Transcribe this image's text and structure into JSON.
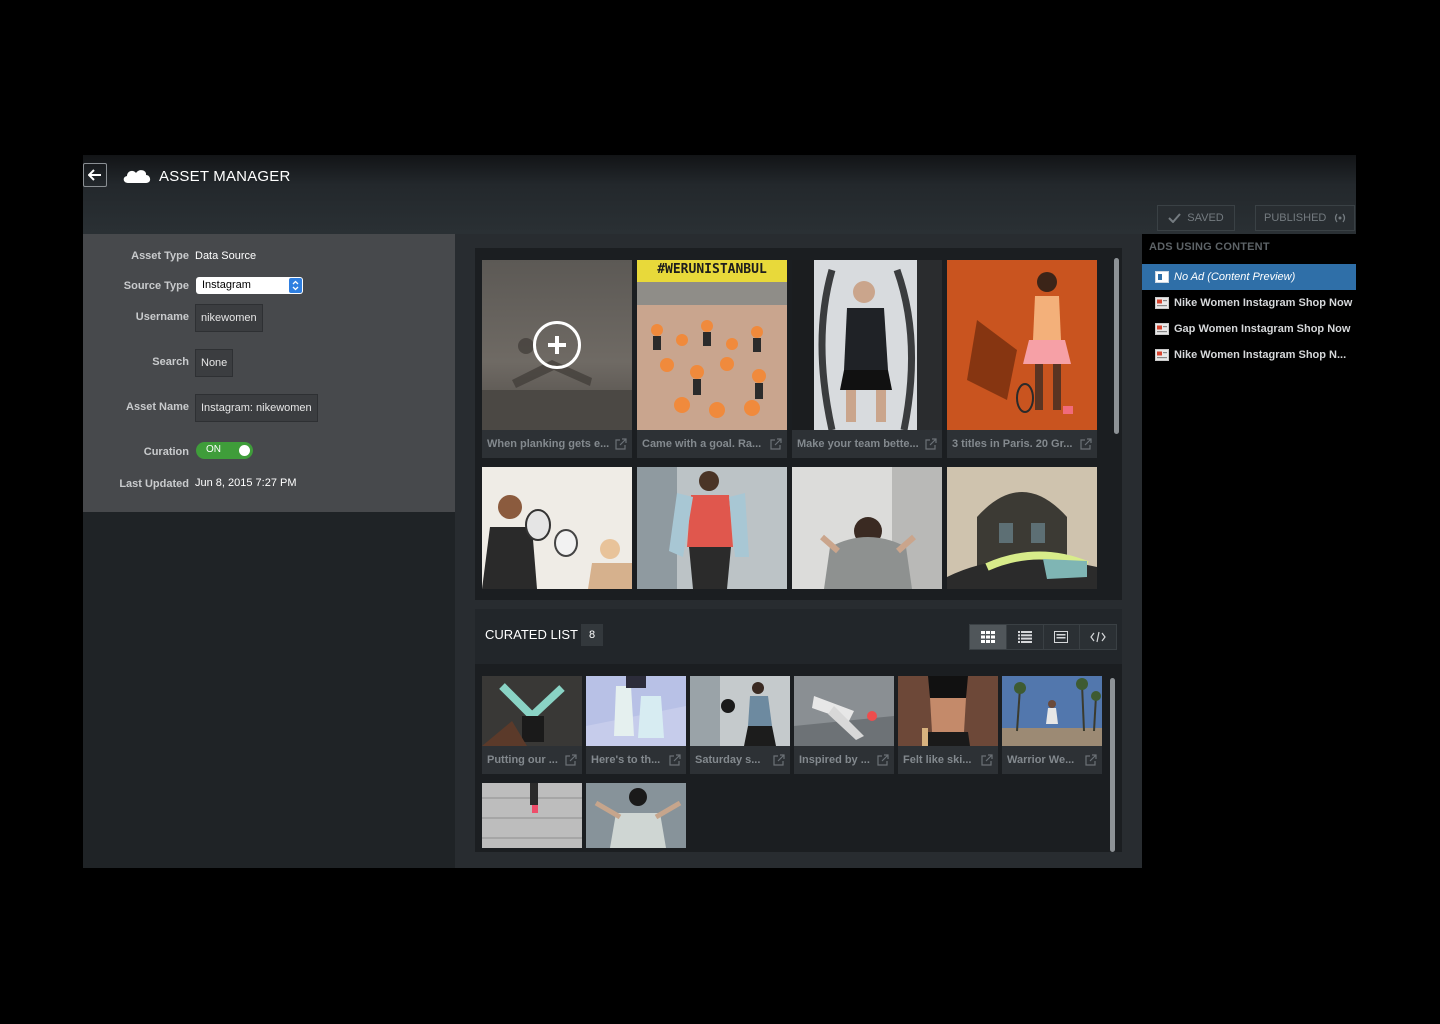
{
  "app": {
    "title": "ASSET MANAGER",
    "saved_label": "SAVED",
    "published_label": "PUBLISHED"
  },
  "form": {
    "asset_type_label": "Asset Type",
    "asset_type_value": "Data Source",
    "source_type_label": "Source Type",
    "source_type_value": "Instagram",
    "username_label": "Username",
    "username_value": "nikewomen",
    "search_label": "Search",
    "search_value": "None",
    "asset_name_label": "Asset Name",
    "asset_name_value": "Instagram: nikewomen",
    "curation_label": "Curation",
    "curation_value": "ON",
    "last_updated_label": "Last Updated",
    "last_updated_value": "Jun 8, 2015 7:27 PM"
  },
  "source_grid": {
    "tiles": [
      {
        "caption": "When planking gets e...",
        "add": true
      },
      {
        "caption": "Came with a goal. Ra..."
      },
      {
        "caption": "Make your team bette..."
      },
      {
        "caption": "3 titles in Paris. 20 Gr..."
      },
      {
        "caption": ""
      },
      {
        "caption": ""
      },
      {
        "caption": ""
      },
      {
        "caption": ""
      }
    ],
    "banner_text": "#WERUNISTANBUL"
  },
  "curated": {
    "title": "CURATED LIST",
    "count": "8",
    "tiles": [
      {
        "caption": "Putting our ..."
      },
      {
        "caption": "Here's to th..."
      },
      {
        "caption": "Saturday s..."
      },
      {
        "caption": "Inspired by ..."
      },
      {
        "caption": "Felt like ski..."
      },
      {
        "caption": "Warrior We..."
      }
    ]
  },
  "ads": {
    "header": "ADS USING CONTENT",
    "items": [
      {
        "label": "No Ad (Content Preview)",
        "selected": true
      },
      {
        "label": "Nike Women Instagram Shop Now"
      },
      {
        "label": "Gap Women Instagram Shop Now"
      },
      {
        "label": "Nike Women Instagram Shop N..."
      }
    ]
  },
  "icons": {
    "back": "back-arrow-icon",
    "logo": "cloud-icon",
    "saved": "checkmark-icon",
    "published": "broadcast-icon",
    "external_link": "external-link-icon",
    "add": "plus-icon",
    "view_grid": "grid-view-icon",
    "view_list": "list-view-icon",
    "view_detail": "detail-view-icon",
    "view_code": "code-view-icon"
  },
  "colors": {
    "selected_ad": "#2f6fa8",
    "toggle_on": "#3f9d3a",
    "select_arrow": "#2f7fe0"
  }
}
